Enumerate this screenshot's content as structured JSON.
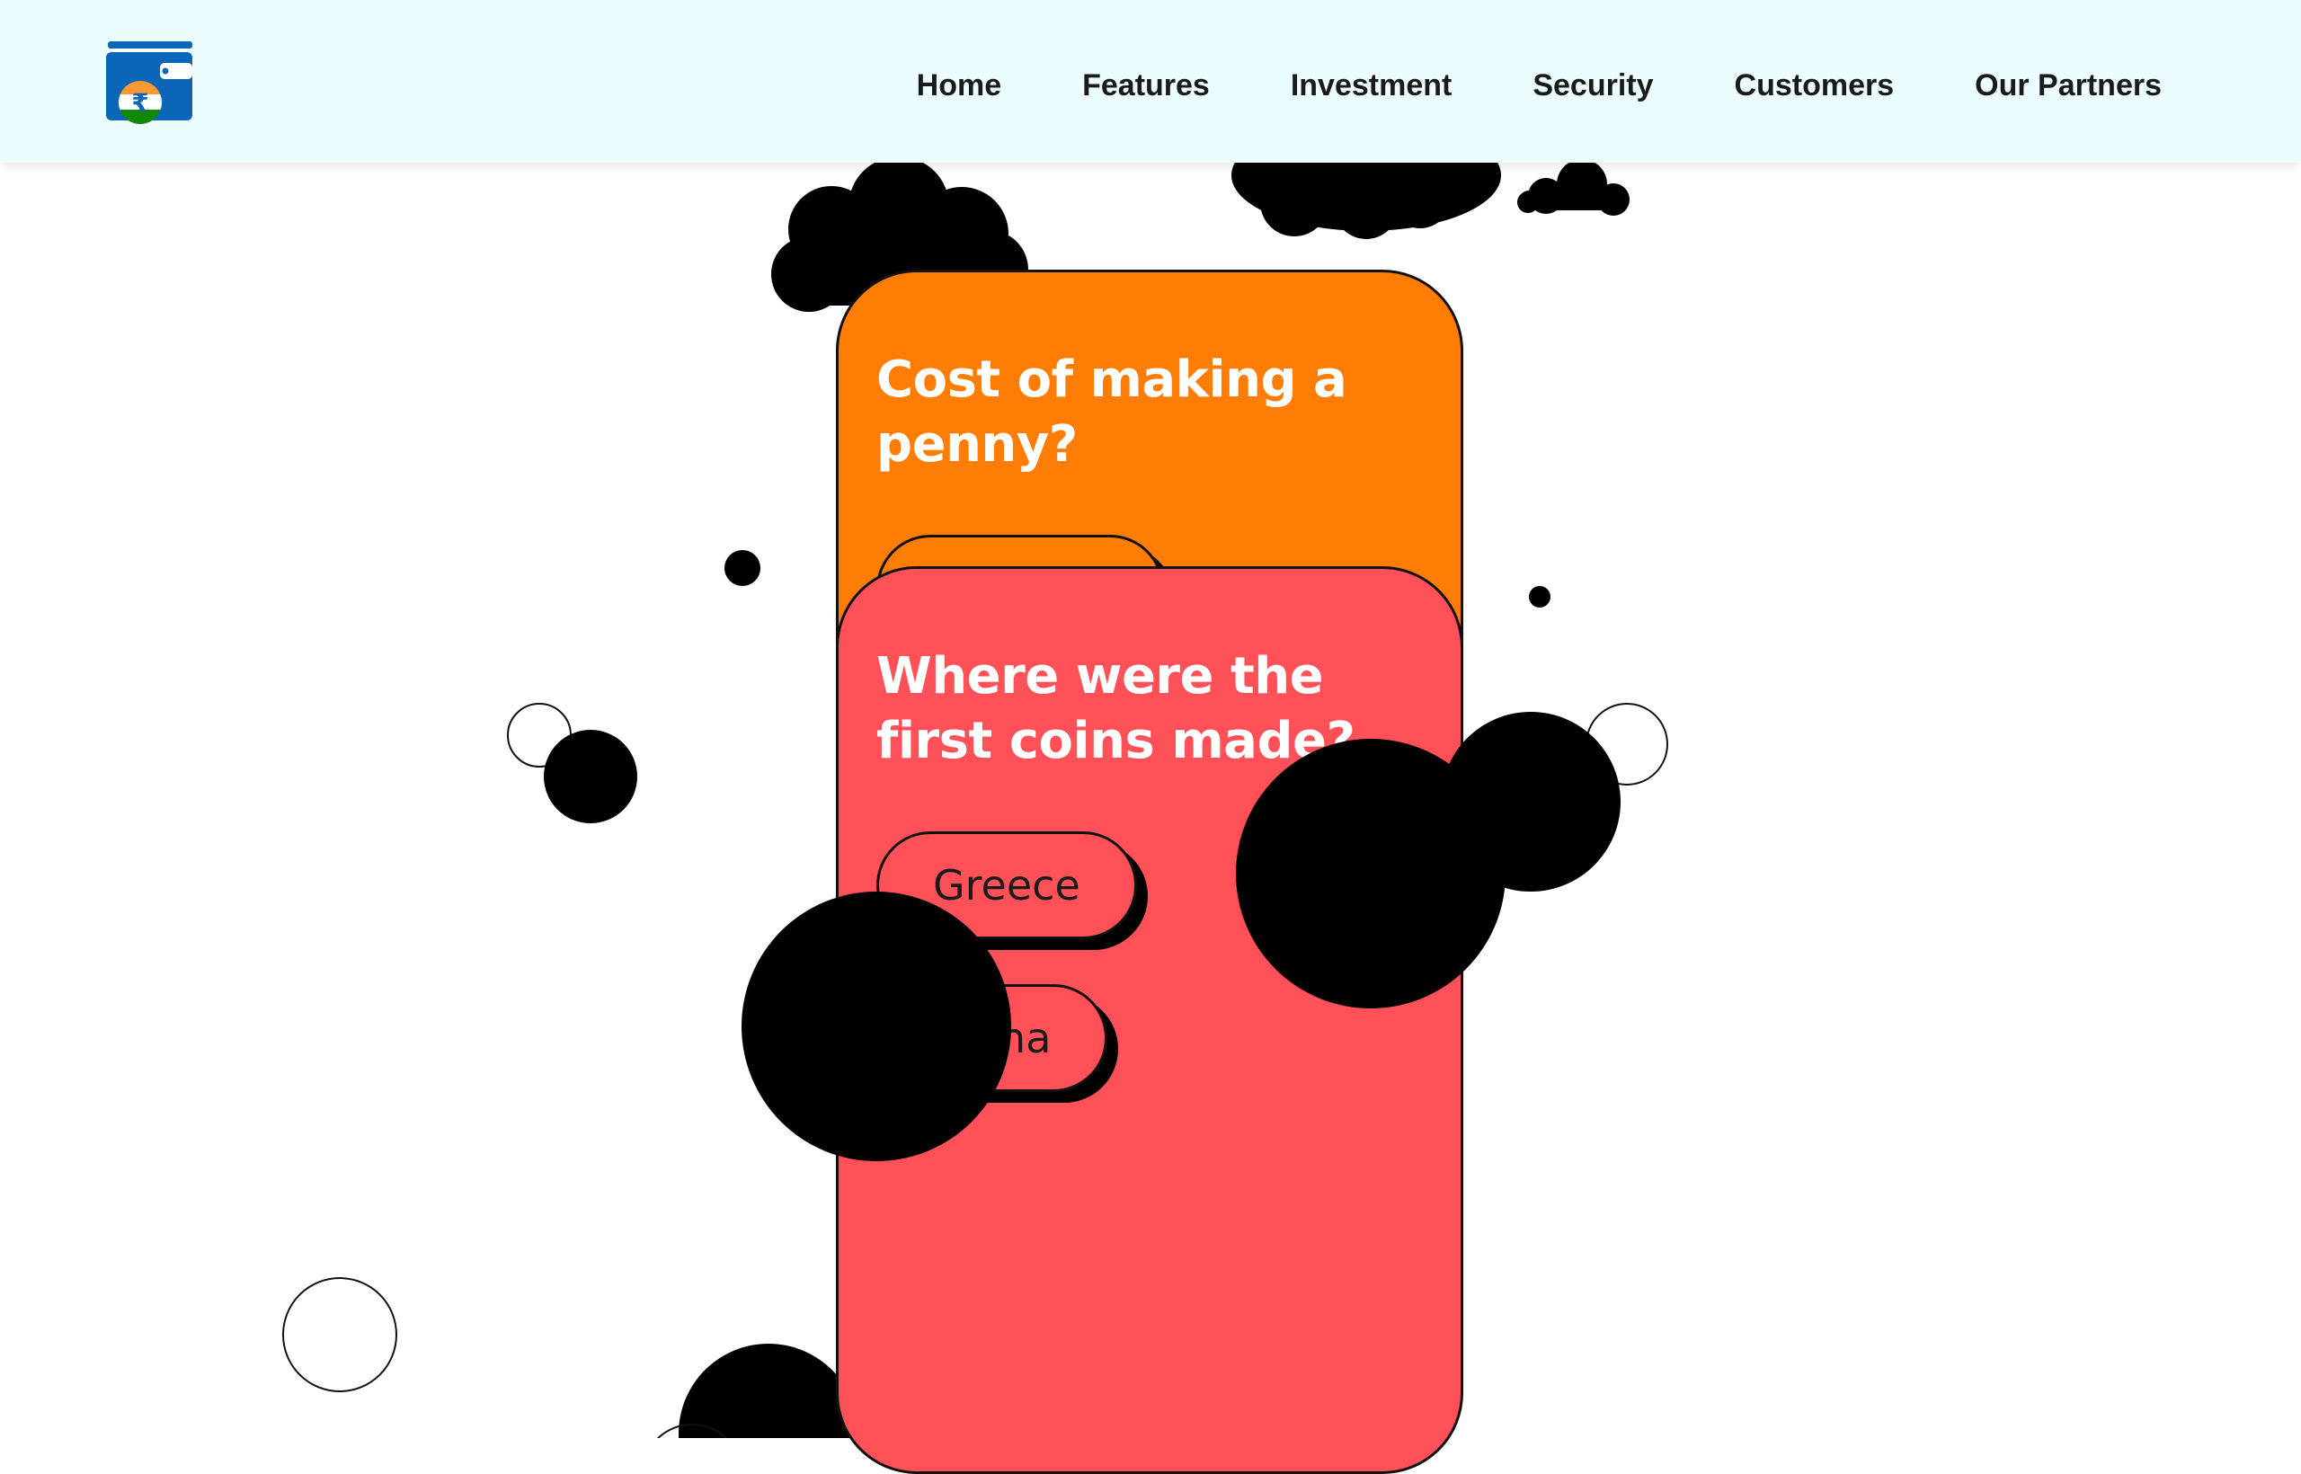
{
  "nav": {
    "logo_icon": "rupee-wallet-icon",
    "links": [
      "Home",
      "Features",
      "Investment",
      "Security",
      "Customers",
      "Our Partners"
    ]
  },
  "quiz": {
    "cards": [
      {
        "question": "Cost of making a penny?",
        "color": "#ff7c05",
        "options": [
          ""
        ]
      },
      {
        "question": "Where were the first coins made?",
        "color": "#ff5157",
        "options": [
          "Greece",
          "China"
        ]
      }
    ]
  },
  "colors": {
    "nav_background": "#ebfdff",
    "card_orange": "#ff7c05",
    "card_red": "#ff5157",
    "logo_blue": "#0b66b8"
  }
}
